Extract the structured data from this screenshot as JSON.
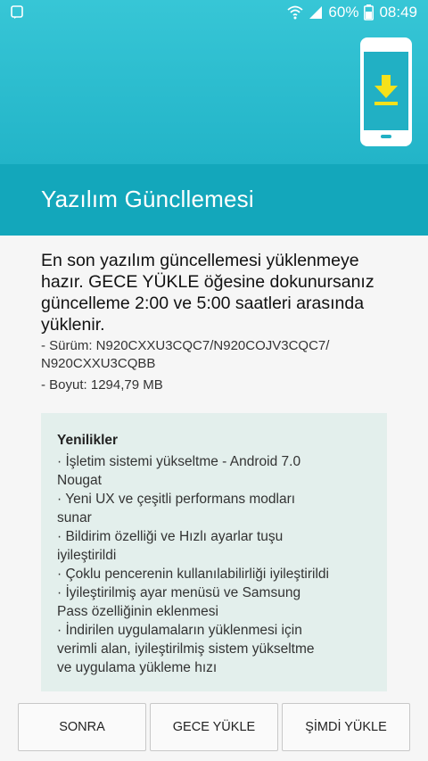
{
  "status": {
    "battery": "60%",
    "time": "08:49",
    "icons": [
      "notification-icon",
      "wifi-icon",
      "signal-icon",
      "battery-icon"
    ]
  },
  "header": {
    "title": "Yazılım Güncllemesi",
    "icon": "phone-download-icon",
    "accent_color": "#22b4c8",
    "download_color": "#f5e11b"
  },
  "body": {
    "intro_lines": [
      "En son yazılım güncellemesi yüklenmeye",
      "hazır. GECE YÜKLE öğesine dokunursanız",
      "güncelleme 2:00 ve 5:00 saatleri arasında",
      "yüklenir."
    ],
    "version_lines": [
      " - Sürüm: N920CXXU3CQC7/N920COJV3CQC7/",
      "N920CXXU3CQBB"
    ],
    "size": " - Boyut: 1294,79 MB"
  },
  "notes": {
    "title": "Yenilikler",
    "lines": [
      "· İşletim sistemi yükseltme - Android 7.0",
      "Nougat",
      "· Yeni UX ve çeşitli performans modları",
      "sunar",
      "· Bildirim özelliği ve Hızlı ayarlar tuşu",
      "iyileştirildi",
      "· Çoklu pencerenin kullanılabilirliği iyileştirildi",
      "· İyileştirilmiş ayar menüsü ve Samsung",
      "Pass özelliğinin eklenmesi",
      "· İndirilen uygulamaların yüklenmesi için",
      "verimli alan, iyileştirilmiş sistem yükseltme",
      "ve uygulama yükleme hızı"
    ]
  },
  "buttons": {
    "later": "SONRA",
    "install_night": "GECE YÜKLE",
    "install_now": "ŞİMDİ YÜKLE"
  }
}
